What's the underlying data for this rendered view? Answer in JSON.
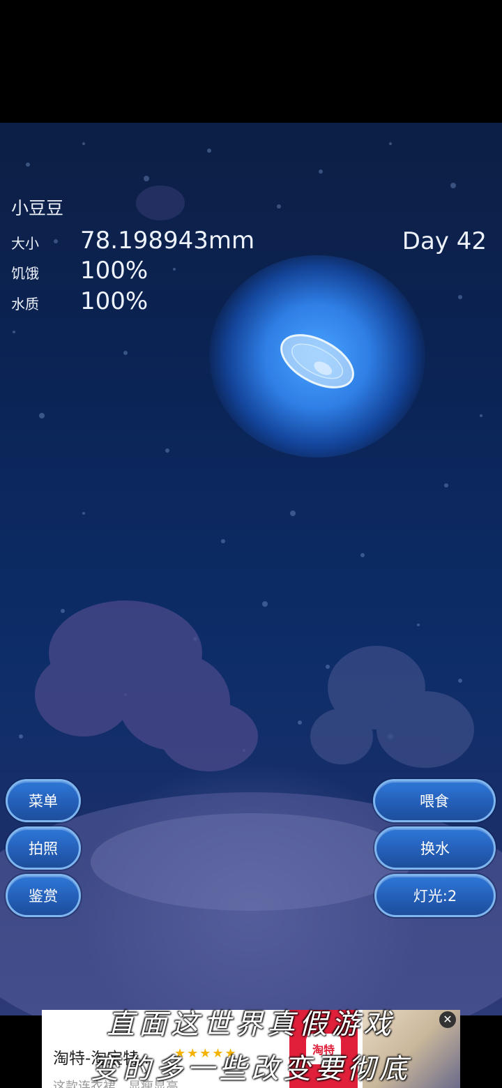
{
  "pet": {
    "name": "小豆豆",
    "size_label": "大小",
    "size_value": "78.198943mm",
    "hunger_label": "饥饿",
    "hunger_value": "100%",
    "water_label": "水质",
    "water_value": "100%",
    "day": "Day 42"
  },
  "buttons": {
    "menu": "菜单",
    "photo": "拍照",
    "appreciate": "鉴赏",
    "feed": "喂食",
    "change_water": "换水",
    "light": "灯光:2"
  },
  "ad": {
    "title": "淘特-淘宝特...",
    "description": "这款连衣裙，显瘦显高",
    "logo_text": "淘特",
    "rating_stars": "★★★★★",
    "close": "✕"
  },
  "caption": {
    "line1": "直面这世界真假游戏",
    "line2": "变的多一些改变要彻底"
  },
  "colors": {
    "button_fill": "#245fb8",
    "button_border": "#7fb6ef",
    "glow": "#4aa3ff",
    "water_deep": "#0b2456"
  }
}
